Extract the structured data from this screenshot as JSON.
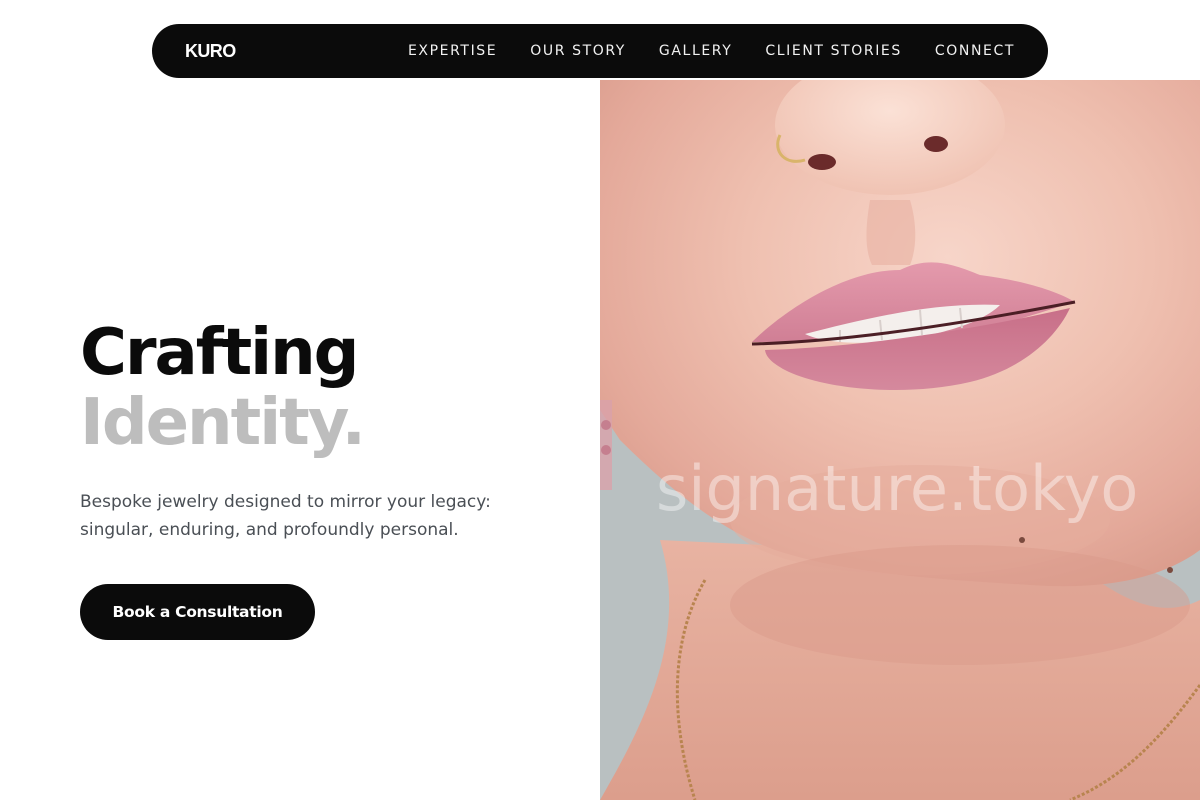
{
  "nav": {
    "brand": "KURO",
    "links": [
      {
        "label": "EXPERTISE"
      },
      {
        "label": "OUR STORY"
      },
      {
        "label": "GALLERY"
      },
      {
        "label": "CLIENT STORIES"
      },
      {
        "label": "CONNECT"
      }
    ]
  },
  "hero": {
    "title_line_1": "Crafting",
    "title_line_2": "Identity.",
    "subtitle": "Bespoke jewelry designed to mirror your legacy: singular, enduring, and profoundly personal.",
    "cta_label": "Book a Consultation",
    "image_watermark": "signature.tokyo"
  },
  "colors": {
    "nav_bg": "#0b0b0b",
    "title_primary": "#0b0b0b",
    "title_muted": "#bdbdbd",
    "body_text": "#4a4f55",
    "cta_bg": "#0b0b0b",
    "page_bg": "#ffffff"
  }
}
